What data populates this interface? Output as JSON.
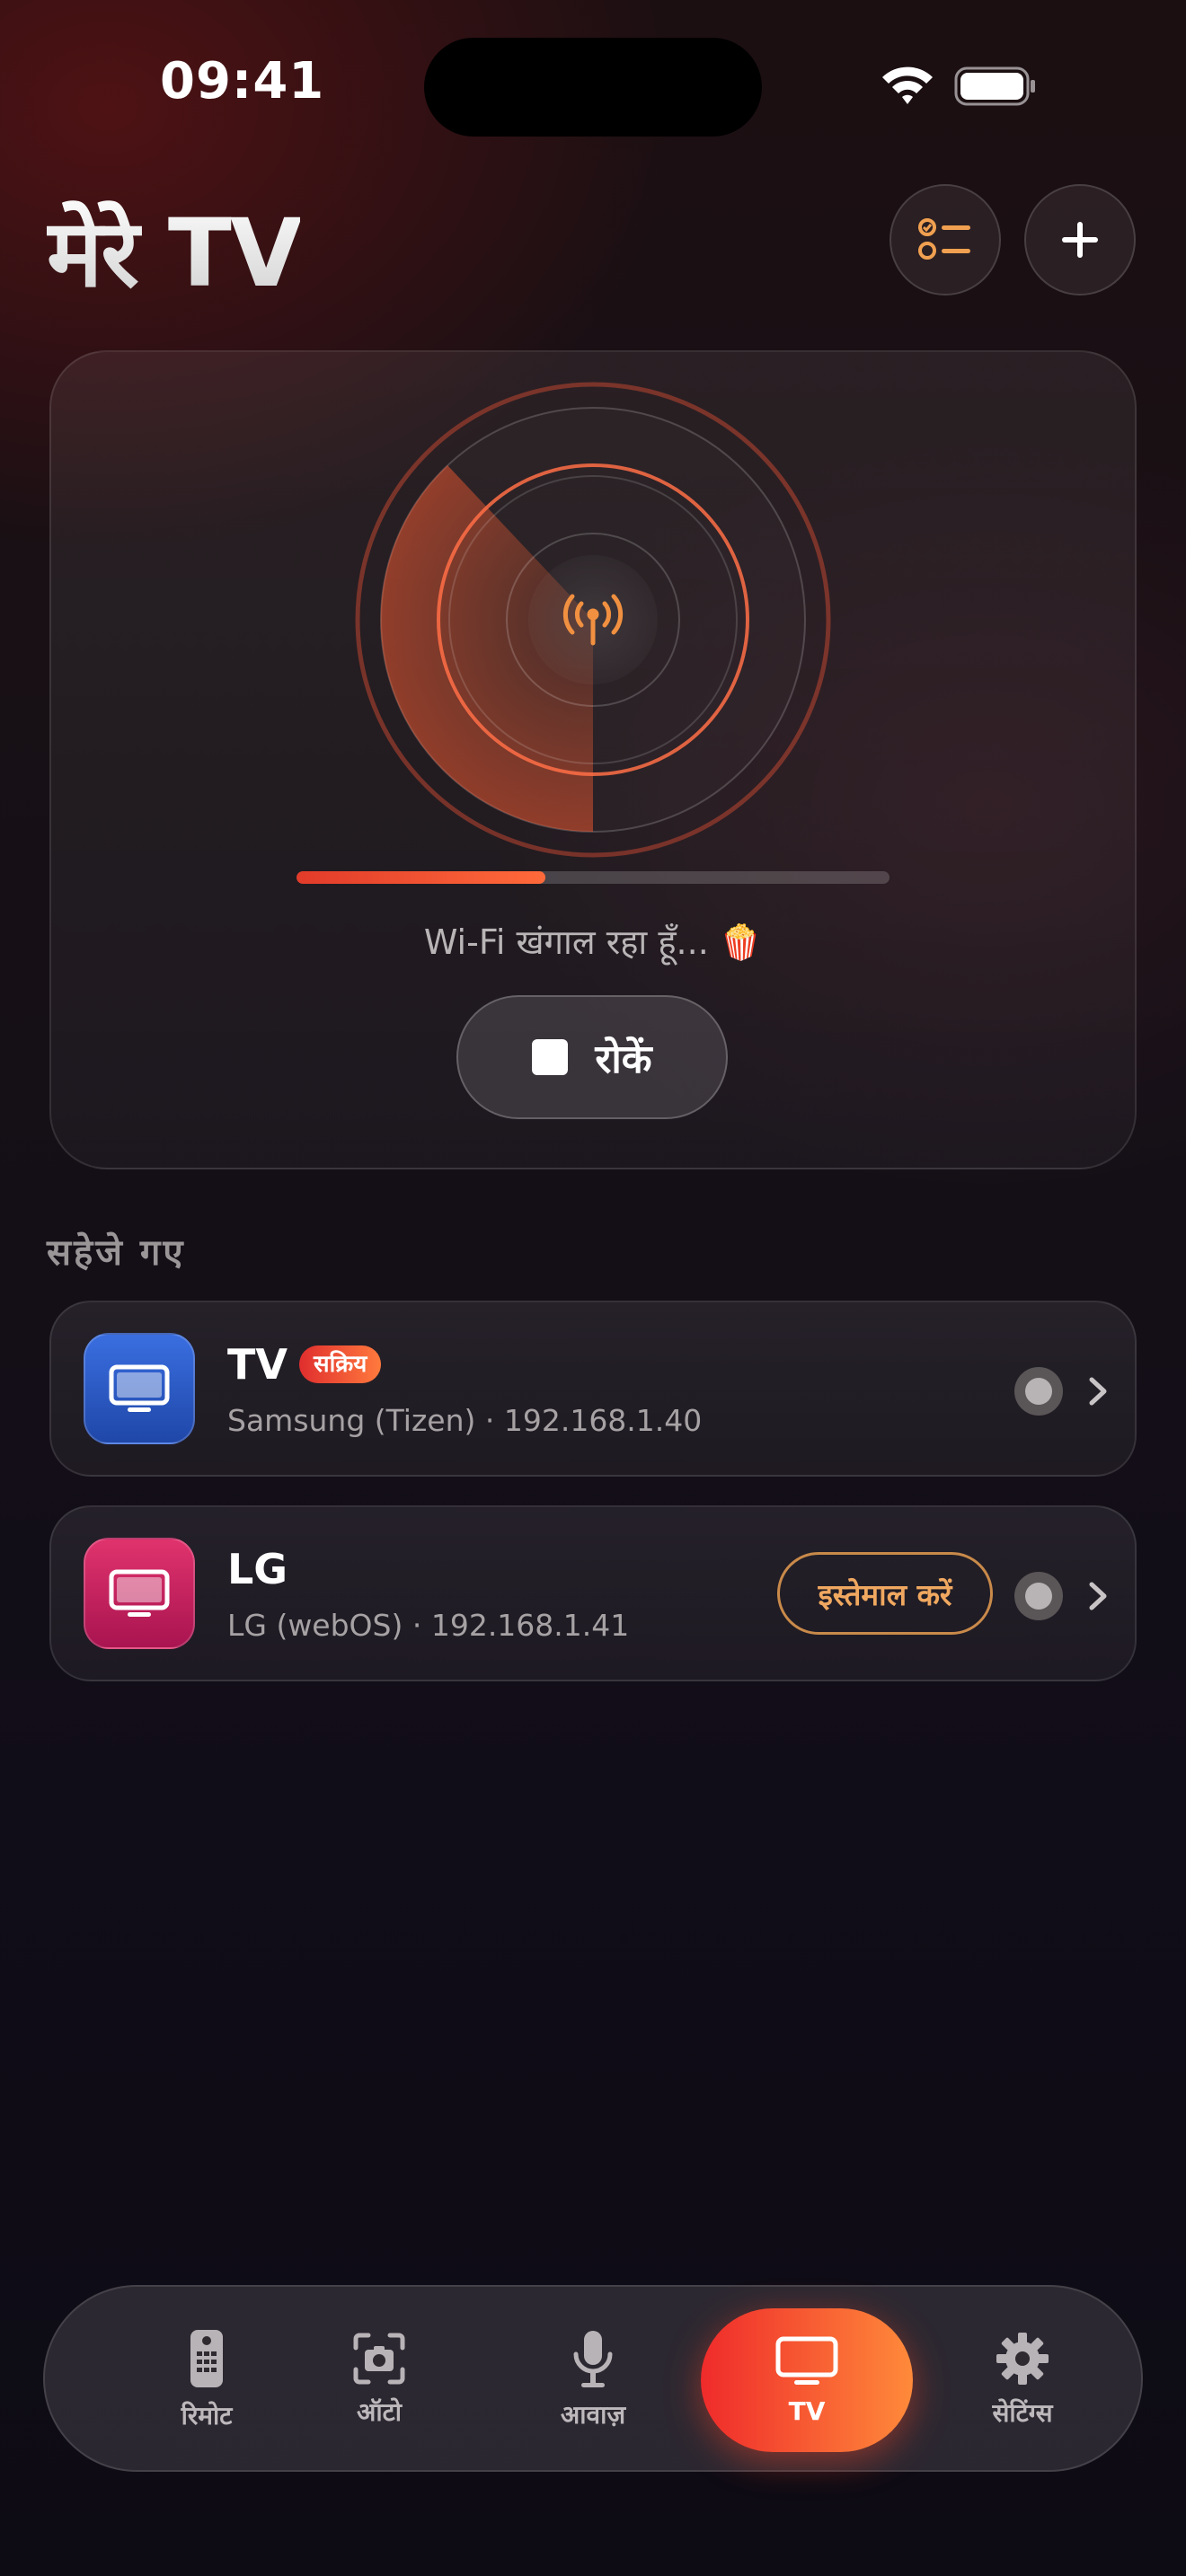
{
  "status_bar": {
    "time": "09:41"
  },
  "header": {
    "title": "मेरे TV"
  },
  "scanner": {
    "progress_percent": 42,
    "status_text": "Wi-Fi खंगाल रहा हूँ... 🍿",
    "stop_label": "रोकें"
  },
  "saved": {
    "title": "सहेजे गए",
    "devices": [
      {
        "name": "TV",
        "badge": "सक्रिय",
        "subtitle": "Samsung (Tizen) · 192.168.1.40",
        "icon": "tv-icon",
        "color": "#2b5cc7"
      },
      {
        "name": "LG",
        "subtitle": "LG (webOS) · 192.168.1.41",
        "action_label": "इस्तेमाल करें",
        "icon": "tv-icon",
        "color": "#c6245f"
      }
    ]
  },
  "tabs": [
    {
      "label": "रिमोट",
      "icon": "remote-icon"
    },
    {
      "label": "ऑटो",
      "icon": "camera-icon"
    },
    {
      "label": "आवाज़",
      "icon": "mic-icon"
    },
    {
      "label": "TV",
      "icon": "tv-icon",
      "active": true
    },
    {
      "label": "सेटिंग्स",
      "icon": "gear-icon"
    }
  ],
  "colors": {
    "accent": "#ff5a36",
    "accent_orange": "#f0a860"
  }
}
